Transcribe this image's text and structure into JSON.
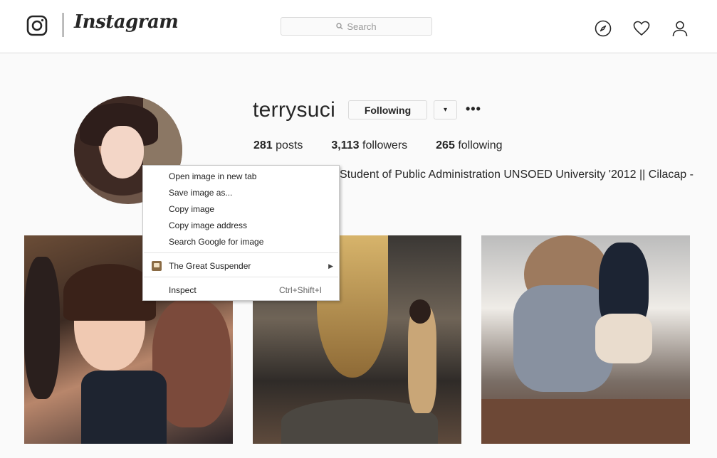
{
  "header": {
    "wordmark": "Instagram",
    "search_placeholder": "Search",
    "icons": [
      "instagram-camera-icon",
      "search-icon",
      "explore-compass-icon",
      "activity-heart-icon",
      "profile-person-icon"
    ]
  },
  "profile": {
    "username": "terrysuci",
    "follow_button_label": "Following",
    "dropdown_symbol": "▾",
    "more_symbol": "•••",
    "stats": {
      "posts_count": "281",
      "posts_label": "posts",
      "followers_count": "3,113",
      "followers_label": "followers",
      "following_count": "265",
      "following_label": "following"
    },
    "bio_visible": "Student of Public Administration UNSOED University '2012 || Cilacap -"
  },
  "context_menu": {
    "items": [
      {
        "label": "Open image in new tab"
      },
      {
        "label": "Save image as..."
      },
      {
        "label": "Copy image"
      },
      {
        "label": "Copy image address"
      },
      {
        "label": "Search Google for image"
      },
      {
        "label": "The Great Suspender",
        "icon": "extension-icon",
        "submenu_arrow": "▶"
      },
      {
        "label": "Inspect",
        "shortcut": "Ctrl+Shift+I"
      }
    ]
  },
  "colors": {
    "border": "#dbdbdb",
    "background": "#fafafa",
    "text": "#262626"
  }
}
